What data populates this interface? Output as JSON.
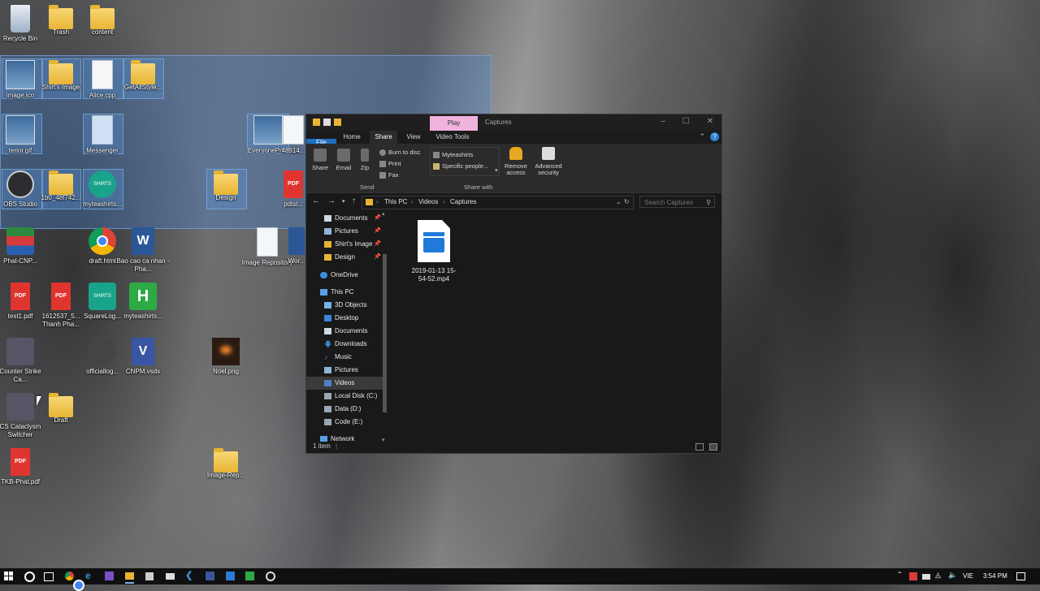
{
  "desktop": {
    "icons": [
      {
        "label": "Recycle Bin",
        "icon": "recycle-bin-icon"
      },
      {
        "label": "Trash",
        "icon": "folder-icon"
      },
      {
        "label": "content",
        "icon": "folder-icon"
      },
      {
        "label": "image.ico",
        "icon": "image-icon"
      },
      {
        "label": "Shirt's Image",
        "icon": "folder-icon"
      },
      {
        "label": "Alice.cpp",
        "icon": "code-file-icon"
      },
      {
        "label": "GetAllStyle...",
        "icon": "folder-icon"
      },
      {
        "label": "EveryonePri...",
        "icon": "image-icon"
      },
      {
        "label": "48914...",
        "icon": "file-icon"
      },
      {
        "label": "terior.gif",
        "icon": "image-icon"
      },
      {
        "label": "Messenger",
        "icon": "document-icon"
      },
      {
        "label": "OBS Studio",
        "icon": "obs-icon"
      },
      {
        "label": "1b0_48f742...",
        "icon": "folder-icon"
      },
      {
        "label": "myteashirts...",
        "icon": "shirt-logo-icon"
      },
      {
        "label": "Design",
        "icon": "folder-icon"
      },
      {
        "label": "pdtsl...",
        "icon": "pdf-icon"
      },
      {
        "label": "Phat-CNP...",
        "icon": "archive-icon"
      },
      {
        "label": "draft.html",
        "icon": "chrome-icon"
      },
      {
        "label": "Bao cao ca nhan - Pha...",
        "icon": "word-icon"
      },
      {
        "label": "Image Repository",
        "icon": "file-icon"
      },
      {
        "label": "Wor...",
        "icon": "word-icon"
      },
      {
        "label": "test1.pdf",
        "icon": "pdf-icon"
      },
      {
        "label": "1612537_5... Thanh Pha...",
        "icon": "pdf-icon"
      },
      {
        "label": "SquareLog...",
        "icon": "shirt-logo-icon"
      },
      {
        "label": "myteashirts...",
        "icon": "h-app-icon"
      },
      {
        "label": "Counter Strike Ca...",
        "icon": "cs-icon"
      },
      {
        "label": "officiallog...",
        "icon": "logo-icon"
      },
      {
        "label": "CNPM.vsdx",
        "icon": "visio-icon"
      },
      {
        "label": "Noel.png",
        "icon": "image-icon"
      },
      {
        "label": "CS Cataclysm Switcher",
        "icon": "cs-icon"
      },
      {
        "label": "Draft",
        "icon": "folder-icon"
      },
      {
        "label": "TKB-Phat.pdf",
        "icon": "pdf-icon"
      },
      {
        "label": "Image-Rep...",
        "icon": "folder-icon"
      }
    ]
  },
  "explorer": {
    "title": "Captures",
    "contextual_tab": "Play",
    "ribbon_tabs": [
      "File",
      "Home",
      "Share",
      "View",
      "Video Tools"
    ],
    "ribbon": {
      "share": "Share",
      "email": "Email",
      "zip": "Zip",
      "burn": "Burn to disc",
      "print": "Print",
      "fax": "Fax",
      "send_group": "Send",
      "share_with_1": "Myteashirts",
      "share_with_2": "Specific people...",
      "share_with_group": "Share with",
      "remove_access": "Remove access",
      "advanced_security": "Advanced security"
    },
    "breadcrumb": [
      "This PC",
      "Videos",
      "Captures"
    ],
    "search_placeholder": "Search Captures",
    "nav": {
      "quick_access": [
        {
          "label": "Documents",
          "pinned": true
        },
        {
          "label": "Pictures",
          "pinned": true
        },
        {
          "label": "Shirt's Image",
          "pinned": true
        },
        {
          "label": "Design",
          "pinned": true
        }
      ],
      "onedrive": "OneDrive",
      "this_pc": "This PC",
      "pc_items": [
        "3D Objects",
        "Desktop",
        "Documents",
        "Downloads",
        "Music",
        "Pictures",
        "Videos",
        "Local Disk (C:)",
        "Data (D:)",
        "Code (E:)"
      ],
      "selected": "Videos",
      "network": "Network"
    },
    "files": [
      {
        "name": "2019-01-13 15-54-52.mp4",
        "icon": "video-file-icon"
      }
    ],
    "status": "1 item"
  },
  "taskbar": {
    "language": "VIE",
    "time": "3:54 PM"
  },
  "colors": {
    "accent": "#1f6fc2",
    "play_tab": "#f0b3dd",
    "window_bg": "#191919",
    "selection": "#4682d2"
  }
}
